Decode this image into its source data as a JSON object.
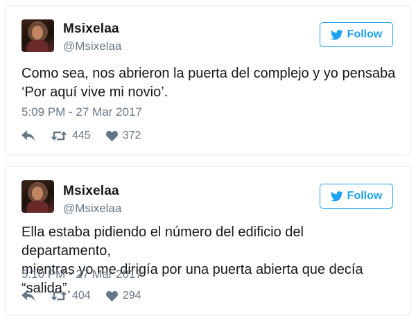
{
  "icons": {
    "bird": "twitter-bird-icon",
    "reply": "reply-icon",
    "retweet": "retweet-icon",
    "like": "heart-icon"
  },
  "colors": {
    "accent": "#1da1f2",
    "text": "#14171a",
    "muted": "#657786",
    "border": "#e1e8ed"
  },
  "tweets": [
    {
      "name": "Msixelaa",
      "handle": "@Msixelaa",
      "follow_label": "Follow",
      "text_line1": "Como sea, nos abrieron la puerta del complejo y yo pensaba",
      "text_line2": "‘Por aquí vive mi novio’.",
      "timestamp": "5:09 PM - 27 Mar 2017",
      "retweets": "445",
      "likes": "372"
    },
    {
      "name": "Msixelaa",
      "handle": "@Msixelaa",
      "follow_label": "Follow",
      "text_line1": "Ella estaba pidiendo el número del edificio del departamento,",
      "text_line2": "mientras yo me dirigía por una puerta abierta que decía “salida”.",
      "timestamp": "5:10 PM - 27 Mar 2017",
      "retweets": "404",
      "likes": "294"
    }
  ]
}
